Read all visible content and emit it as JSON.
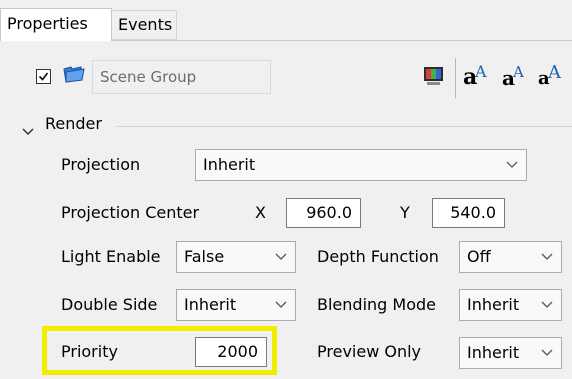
{
  "tabs": [
    {
      "label": "Properties",
      "active": true
    },
    {
      "label": "Events",
      "active": false
    }
  ],
  "header": {
    "enabled_checked": true,
    "name_placeholder": "Scene Group",
    "toolbar_icons": [
      "palette-icon",
      "font-bold-icon",
      "font-regular-icon",
      "font-large-icon"
    ]
  },
  "section": {
    "title": "Render",
    "expanded": true
  },
  "fields": {
    "projection": {
      "label": "Projection",
      "value": "Inherit"
    },
    "projection_center": {
      "label": "Projection Center",
      "x_label": "X",
      "x_value": "960.0",
      "y_label": "Y",
      "y_value": "540.0"
    },
    "light_enable": {
      "label": "Light Enable",
      "value": "False"
    },
    "depth_function": {
      "label": "Depth Function",
      "value": "Off"
    },
    "double_side": {
      "label": "Double Side",
      "value": "Inherit"
    },
    "blending_mode": {
      "label": "Blending Mode",
      "value": "Inherit"
    },
    "priority": {
      "label": "Priority",
      "value": "2000"
    },
    "preview_only": {
      "label": "Preview Only",
      "value": "Inherit"
    }
  },
  "colors": {
    "highlight": "#f2ec00",
    "background": "#f0f0f0",
    "font_icon_blue": "#1d5fb2"
  }
}
